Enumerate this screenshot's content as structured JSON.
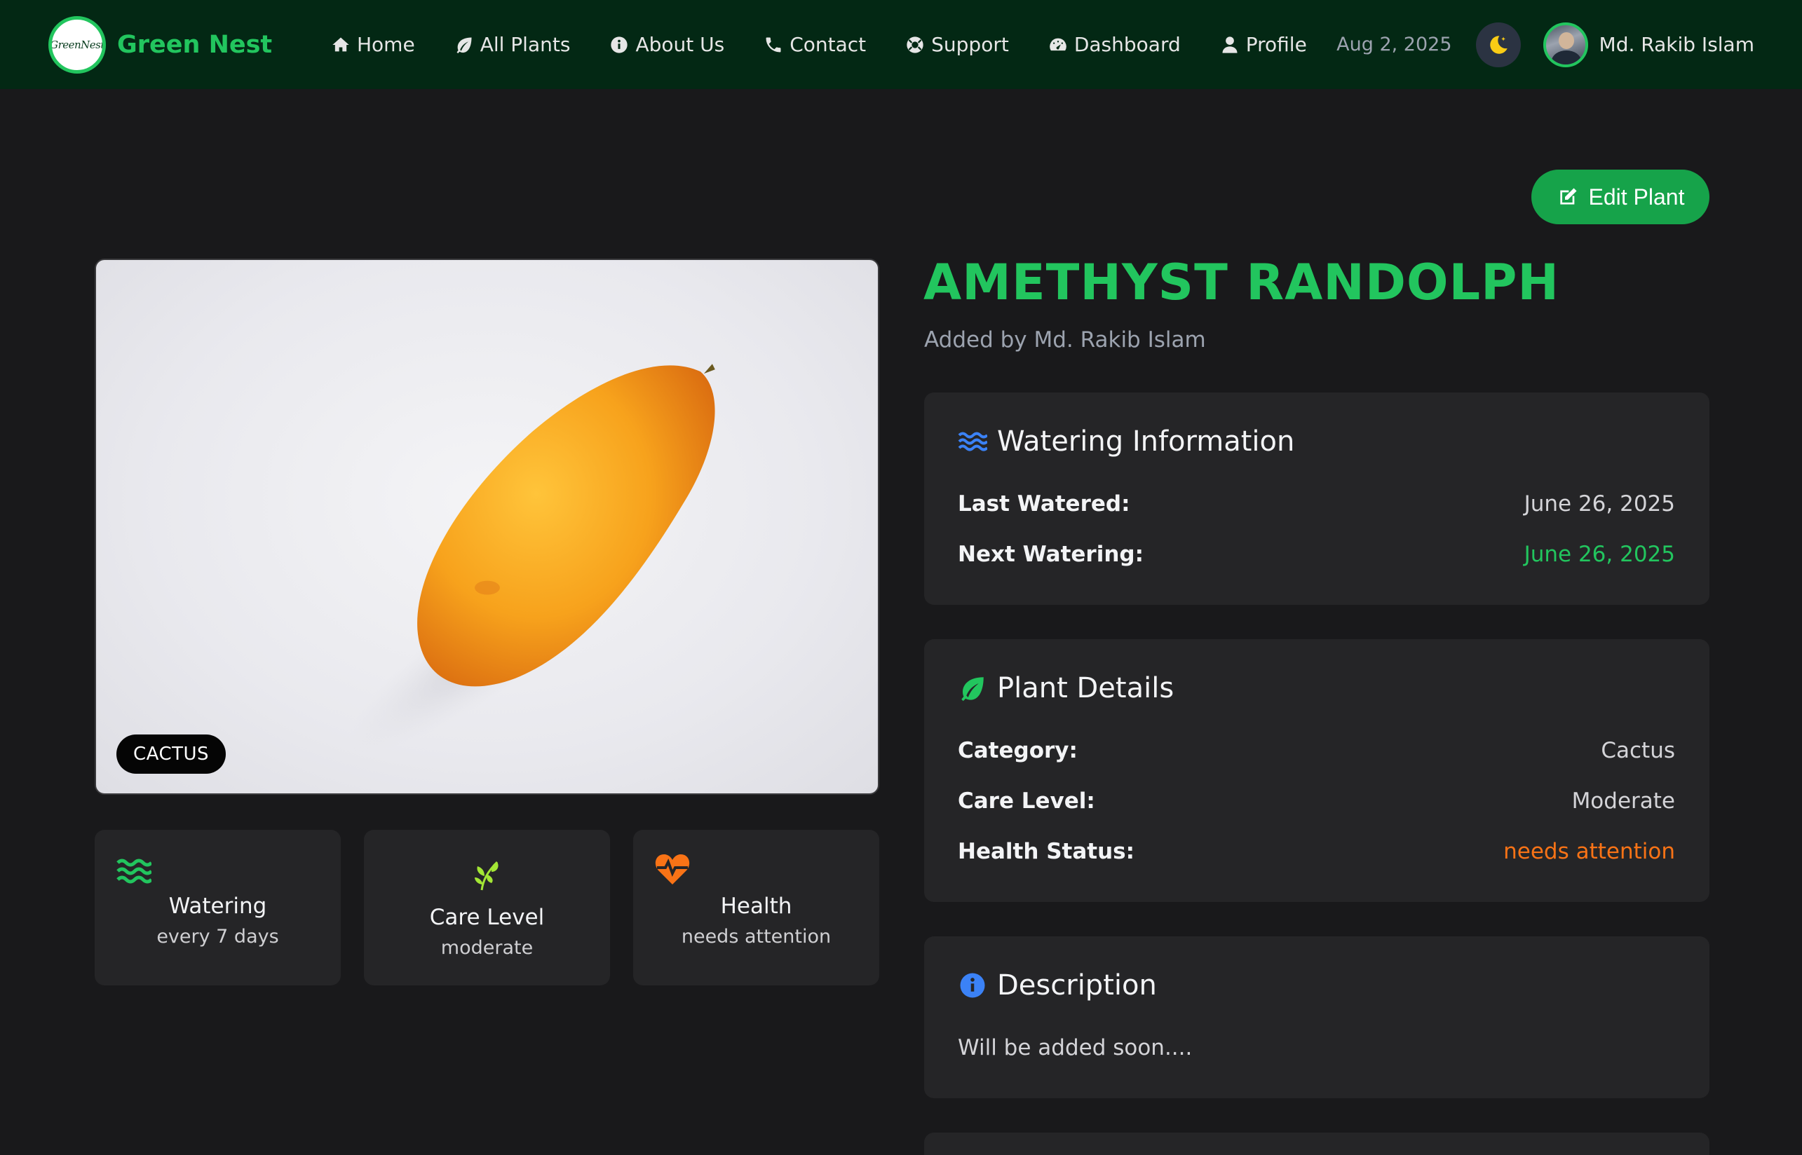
{
  "colors": {
    "brand_green": "#22c55e",
    "button_green": "#16a34a",
    "nav_bg": "#032814",
    "page_bg": "#19191b",
    "card_bg": "#252527",
    "warning_orange": "#f97316",
    "info_blue": "#3b82f6"
  },
  "nav": {
    "brand": "Green Nest",
    "logo_text": "GreenNest",
    "links": [
      {
        "label": "Home",
        "icon": "home-icon"
      },
      {
        "label": "All Plants",
        "icon": "leaf-icon"
      },
      {
        "label": "About Us",
        "icon": "info-icon"
      },
      {
        "label": "Contact",
        "icon": "phone-icon"
      },
      {
        "label": "Support",
        "icon": "lifebuoy-icon"
      },
      {
        "label": "Dashboard",
        "icon": "gauge-icon"
      },
      {
        "label": "Profile",
        "icon": "user-icon"
      }
    ],
    "date": "Aug 2, 2025",
    "theme_icon": "moon-icon",
    "user_name": "Md. Rakib Islam"
  },
  "actions": {
    "edit_label": "Edit Plant"
  },
  "plant": {
    "name": "AMETHYST RANDOLPH",
    "added_by": "Added by Md. Rakib Islam",
    "category_badge": "CACTUS"
  },
  "stats": [
    {
      "title": "Watering",
      "value": "every 7 days",
      "icon": "water-icon"
    },
    {
      "title": "Care Level",
      "value": "moderate",
      "icon": "seedling-icon"
    },
    {
      "title": "Health",
      "value": "needs attention",
      "icon": "heartbeat-icon"
    }
  ],
  "watering": {
    "heading": "Watering Information",
    "last_label": "Last Watered:",
    "last_value": "June 26, 2025",
    "next_label": "Next Watering:",
    "next_value": "June 26, 2025"
  },
  "details": {
    "heading": "Plant Details",
    "category_label": "Category:",
    "category_value": "Cactus",
    "care_label": "Care Level:",
    "care_value": "Moderate",
    "health_label": "Health Status:",
    "health_value": "needs attention"
  },
  "description": {
    "heading": "Description",
    "text": "Will be added soon...."
  }
}
